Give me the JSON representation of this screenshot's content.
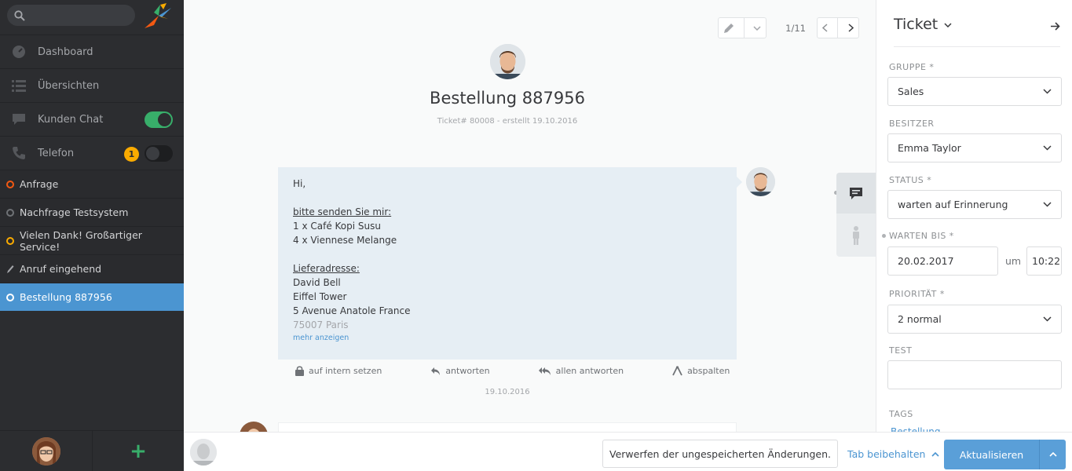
{
  "sidebar": {
    "search_placeholder": "",
    "nav": [
      {
        "label": "Dashboard",
        "icon": "dashboard-icon"
      },
      {
        "label": "Übersichten",
        "icon": "list-icon"
      },
      {
        "label": "Kunden Chat",
        "icon": "chat-icon",
        "toggle": true
      },
      {
        "label": "Telefon",
        "icon": "phone-icon",
        "toggle": false,
        "badge": "1"
      }
    ],
    "tasks": [
      {
        "label": "Anfrage",
        "status_color": "#f35912"
      },
      {
        "label": "Nachfrage Testsystem",
        "status_color": "#6f7276"
      },
      {
        "label": "Vielen Dank! Großartiger Service!",
        "status_color": "#faab00"
      },
      {
        "label": "Anruf eingehend",
        "status_color": "#a4a6aa",
        "icon": "pencil-icon"
      },
      {
        "label": "Bestellung 887956",
        "status_color": "#ffffff",
        "active": true
      }
    ]
  },
  "main": {
    "pager": "1/11",
    "title": "Bestellung 887956",
    "meta": "Ticket# 80008 - erstellt 19.10.2016",
    "article": {
      "greeting": "Hi,",
      "line1": "bitte senden Sie mir:",
      "line2": "1 x Café Kopi Susu",
      "line3": "4 x Viennese Melange",
      "line4": "Lieferadresse:",
      "line5": "David Bell",
      "line6": "Eiffel Tower",
      "line7": "5 Avenue Anatole France",
      "line8": "75007 Paris",
      "more": "mehr anzeigen"
    },
    "actions": {
      "internal": "auf intern setzen",
      "reply": "antworten",
      "reply_all": "allen antworten",
      "split": "abspalten"
    },
    "date": "19.10.2016"
  },
  "right": {
    "title": "Ticket",
    "gruppe_label": "GRUPPE *",
    "gruppe": "Sales",
    "besitzer_label": "BESITZER",
    "besitzer": "Emma Taylor",
    "status_label": "STATUS *",
    "status": "warten auf Erinnerung",
    "warten_label": "WARTEN BIS *",
    "warten_date": "20.02.2017",
    "um": "um",
    "warten_time": "10:22",
    "prio_label": "PRIORITÄT *",
    "prio": "2 normal",
    "test_label": "TEST",
    "tags_label": "TAGS",
    "tag": "Bestellung"
  },
  "bottom": {
    "discard": "Verwerfen der ungespeicherten Änderungen.",
    "tab_keep": "Tab beibehalten",
    "update": "Aktualisieren"
  },
  "colors": {
    "accent": "#4b95d1",
    "success": "#38ae6a",
    "warning": "#faab00"
  }
}
